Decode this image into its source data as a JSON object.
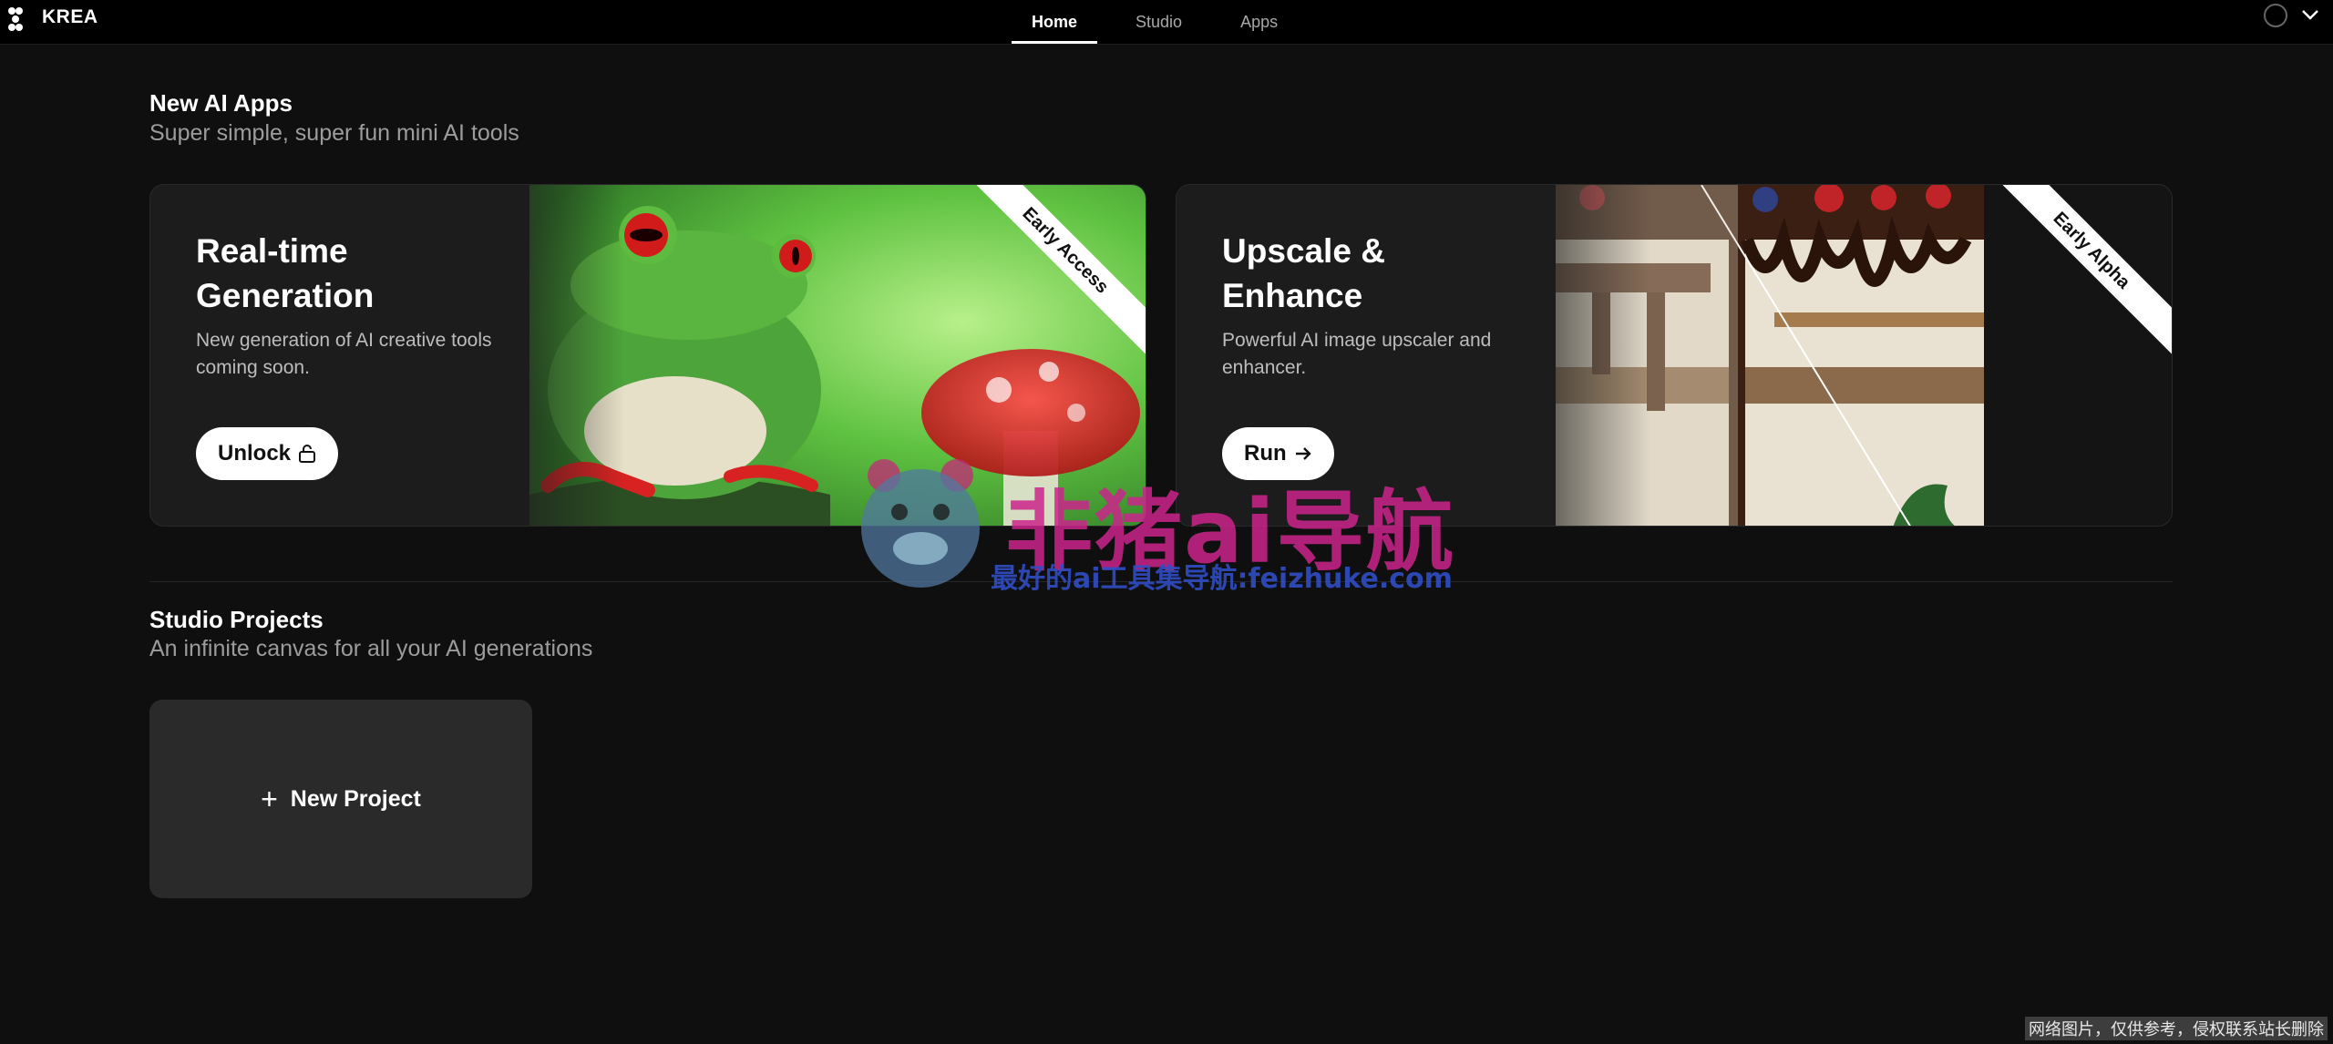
{
  "brand": {
    "name": "KREA"
  },
  "nav": {
    "tabs": [
      {
        "label": "Home",
        "active": true
      },
      {
        "label": "Studio"
      },
      {
        "label": "Apps"
      }
    ]
  },
  "header_icons": {
    "avatar": "avatar-circle-icon",
    "menu": "chevron-down-icon"
  },
  "apps_section": {
    "title": "New AI Apps",
    "subtitle": "Super simple, super fun mini AI tools",
    "cards": [
      {
        "title": "Real-time Generation",
        "description": "New generation of AI creative tools coming soon.",
        "button_label": "Unlock",
        "button_icon": "lock-icon",
        "ribbon": "Early Access",
        "art": "frog-and-mushroom-image"
      },
      {
        "title": "Upscale & Enhance",
        "description": "Powerful AI image upscaler and enhancer.",
        "button_label": "Run",
        "button_icon": "arrow-right-icon",
        "ribbon": "Early Alpha",
        "art": "cake-before-after-image"
      }
    ]
  },
  "projects_section": {
    "title": "Studio Projects",
    "subtitle": "An infinite canvas for all your AI generations",
    "new_project_label": "New Project"
  },
  "watermark": {
    "main": "非猪ai导航",
    "sub": "最好的ai工具集导航:feizhuke.com"
  },
  "corner_note": "网络图片，仅供参考，侵权联系站长删除",
  "colors": {
    "background": "#0f0f0f",
    "topbar": "#000000",
    "card": "#1b1b1b",
    "accent": "#ffffff"
  }
}
